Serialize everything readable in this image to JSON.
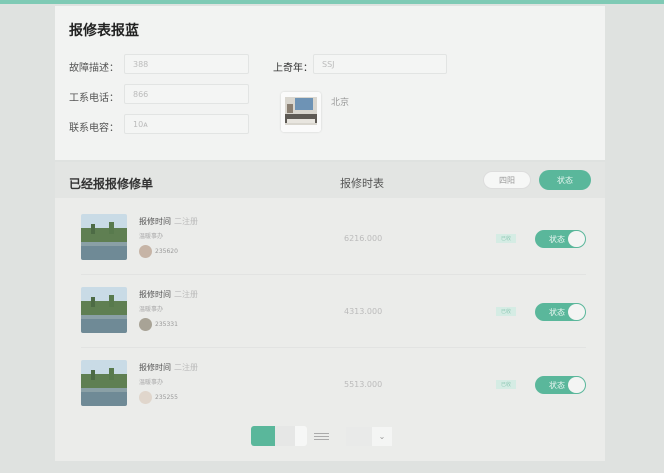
{
  "form": {
    "title": "报修表报蓝",
    "fields": [
      {
        "label": "故障描述：",
        "value": "388"
      },
      {
        "label": "工系电话：",
        "value": "866"
      },
      {
        "label": "联系电容：",
        "value": "10ᴀ"
      }
    ],
    "year_field": {
      "label": "上奇年：",
      "value": "SSJ"
    },
    "thumb_location": "北京"
  },
  "list": {
    "title": "已经报报修修单",
    "column_title": "报修时表",
    "back_label": "四阳",
    "status_label": "状态",
    "rows": [
      {
        "time_label": "报修时间",
        "time_sub": "二注册",
        "desc": "温暖事办",
        "user": "235620",
        "number": "6216.000",
        "tag": "已收",
        "toggle_label": "状态"
      },
      {
        "time_label": "报修时间",
        "time_sub": "二注册",
        "desc": "温暖事办",
        "user": "235331",
        "number": "4313.000",
        "tag": "已收",
        "toggle_label": "状态"
      },
      {
        "time_label": "报修时间",
        "time_sub": "二注册",
        "desc": "温暖事办",
        "user": "235255",
        "number": "5513.000",
        "tag": "已收",
        "toggle_label": "状态"
      }
    ]
  },
  "colors": {
    "accent": "#5ab79b",
    "topbar": "#7fcab5"
  },
  "icons": {
    "pager_menu": "menu-lines-icon",
    "dropdown": "chevron-down-icon"
  }
}
